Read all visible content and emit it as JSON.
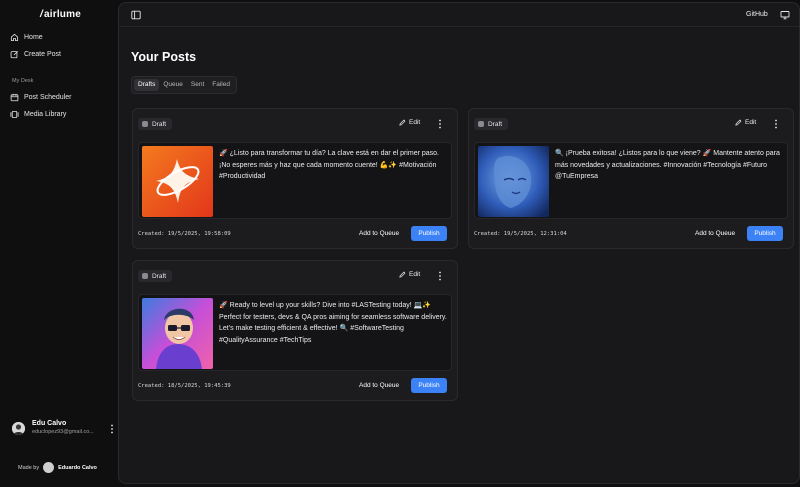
{
  "app": {
    "name": "airlume",
    "logo_mark": "/"
  },
  "sidebar": {
    "items": [
      {
        "label": "Home",
        "icon": "home-icon"
      },
      {
        "label": "Create Post",
        "icon": "create-post-icon"
      }
    ],
    "section_label": "My Desk",
    "desk_items": [
      {
        "label": "Post Scheduler",
        "icon": "calendar-icon"
      },
      {
        "label": "Media Library",
        "icon": "media-library-icon"
      }
    ],
    "user": {
      "name": "Edu Calvo",
      "email": "educlopez93@gmail.co..."
    },
    "made_by": {
      "label": "Made by",
      "name": "Eduardo Calvo"
    }
  },
  "header": {
    "github_label": "GitHub"
  },
  "main": {
    "title": "Your Posts",
    "tabs": [
      {
        "label": "Drafts",
        "active": true
      },
      {
        "label": "Queue",
        "active": false
      },
      {
        "label": "Sent",
        "active": false
      },
      {
        "label": "Failed",
        "active": false
      }
    ]
  },
  "posts": [
    {
      "status": "Draft",
      "edit_label": "Edit",
      "text": "🚀 ¿Listo para transformar tu día? La clave está en dar el primer paso. ¡No esperes más y haz que cada momento cuente! 💪✨ #Motivación #Productividad",
      "created": "Created: 19/5/2025, 19:58:09",
      "queue_label": "Add to Queue",
      "publish_label": "Publish"
    },
    {
      "status": "Draft",
      "edit_label": "Edit",
      "text": "🔍 ¡Prueba exitosa! ¿Listos para lo que viene? 🚀 Mantente atento para más novedades y actualizaciones. #Innovación #Tecnología #Futuro @TuEmpresa",
      "created": "Created: 19/5/2025, 12:31:04",
      "queue_label": "Add to Queue",
      "publish_label": "Publish"
    },
    {
      "status": "Draft",
      "edit_label": "Edit",
      "text": "🚀 Ready to level up your skills? Dive into #LASTesting today! 💻✨ Perfect for testers, devs & QA pros aiming for seamless software delivery. Let's make testing efficient & effective! 🔍 #SoftwareTesting #QualityAssurance #TechTips",
      "created": "Created: 18/5/2025, 19:45:39",
      "queue_label": "Add to Queue",
      "publish_label": "Publish"
    }
  ],
  "colors": {
    "accent": "#3b82f6",
    "background": "#0f0f10",
    "panel": "#18181a"
  }
}
